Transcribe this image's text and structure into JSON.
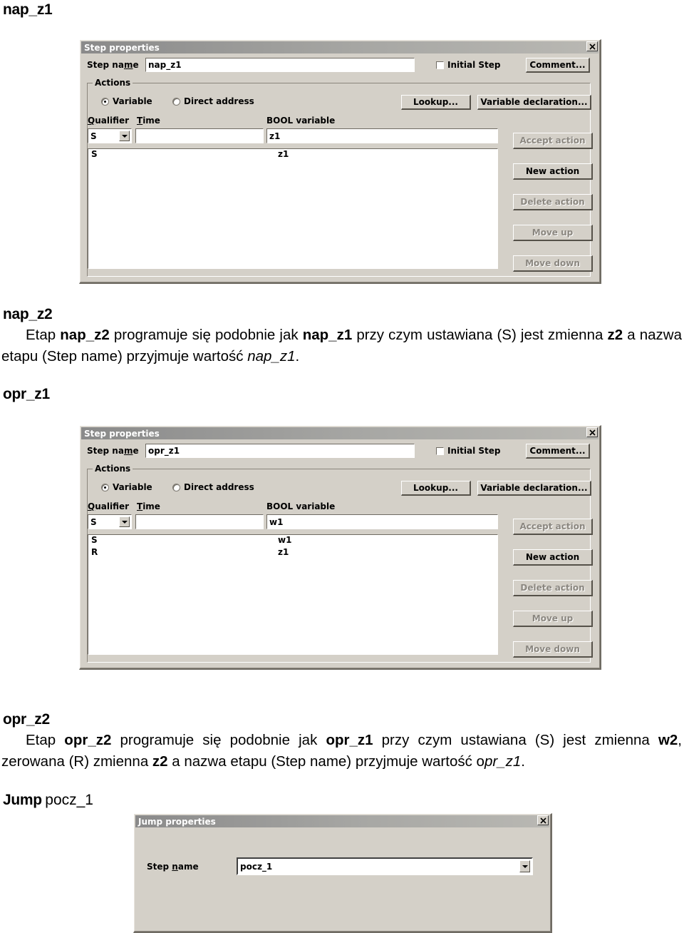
{
  "document": {
    "headings": {
      "nap_z1": "nap_z1",
      "nap_z2": "nap_z2",
      "opr_z1": "opr_z1",
      "opr_z2": "opr_z2",
      "jump": "Jump",
      "jump_target": "pocz_1"
    },
    "paragraphs": {
      "nap_z2": {
        "t1": "Etap ",
        "b1": "nap_z2",
        "t2": " programuje się podobnie jak ",
        "b2": "nap_z1",
        "t3": " przy czym ustawiana (S) jest zmienna ",
        "b3": "z2",
        "t4": " a nazwa etapu (Step name) przyjmuje wartość ",
        "i1": "nap_z1",
        "t5": "."
      },
      "opr_z2": {
        "t1": "Etap ",
        "b1": "opr_z2",
        "t2": " programuje się podobnie jak ",
        "b2": "opr_z1",
        "t3": " przy czym ustawiana (S) jest zmienna ",
        "b3": "w2",
        "t4": ", zerowana (R) zmienna ",
        "b4": "z2",
        "t5": " a nazwa etapu (Step name) przyjmuje wartość o",
        "i1": "pr_z1",
        "t6": "."
      }
    }
  },
  "dialog_step1": {
    "title": "Step properties",
    "close_icon": "close-icon",
    "step_name_label": "Step na",
    "step_name_label_underlined": "m",
    "step_name_label_tail": "e",
    "step_name_value": "nap_z1",
    "initial_step_label": "Initial Step",
    "initial_step_checked": false,
    "comment_button": "Comment...",
    "actions_group_label": "Actions",
    "radio_variable": "Variable",
    "radio_direct_address": "Direct address",
    "radio_selected": "Variable",
    "lookup_button": "Lookup...",
    "variable_declaration_button": "Variable declaration...",
    "qualifier_label_head": "Q",
    "qualifier_label_tail": "ualifier",
    "time_label_head": "T",
    "time_label_tail": "ime",
    "bool_variable_label": "BOOL variable",
    "qualifier_value": "S",
    "time_value": "",
    "bool_variable_value": "z1",
    "action_rows": [
      {
        "qualifier": "S",
        "variable": "z1"
      }
    ],
    "buttons": [
      {
        "label": "Accept action",
        "disabled": true
      },
      {
        "label": "New action",
        "disabled": false
      },
      {
        "label": "Delete action",
        "disabled": true
      },
      {
        "label": "Move up",
        "disabled": true
      },
      {
        "label": "Move down",
        "disabled": true
      }
    ]
  },
  "dialog_step2": {
    "title": "Step properties",
    "close_icon": "close-icon",
    "step_name_label": "Step na",
    "step_name_label_underlined": "m",
    "step_name_label_tail": "e",
    "step_name_value": "opr_z1",
    "initial_step_label": "Initial Step",
    "initial_step_checked": false,
    "comment_button": "Comment...",
    "actions_group_label": "Actions",
    "radio_variable": "Variable",
    "radio_direct_address": "Direct address",
    "radio_selected": "Variable",
    "lookup_button": "Lookup...",
    "variable_declaration_button": "Variable declaration...",
    "qualifier_label_head": "Q",
    "qualifier_label_tail": "ualifier",
    "time_label_head": "T",
    "time_label_tail": "ime",
    "bool_variable_label": "BOOL variable",
    "qualifier_value": "S",
    "time_value": "",
    "bool_variable_value": "w1",
    "action_rows": [
      {
        "qualifier": "S",
        "variable": "w1"
      },
      {
        "qualifier": "R",
        "variable": "z1"
      }
    ],
    "buttons": [
      {
        "label": "Accept action",
        "disabled": true
      },
      {
        "label": "New action",
        "disabled": false
      },
      {
        "label": "Delete action",
        "disabled": true
      },
      {
        "label": "Move up",
        "disabled": true
      },
      {
        "label": "Move down",
        "disabled": true
      }
    ]
  },
  "dialog_jump": {
    "title": "Jump properties",
    "close_icon": "close-icon",
    "step_name_label": "Step ",
    "step_name_label_underlined": "n",
    "step_name_label_tail": "ame",
    "step_name_value": "pocz_1",
    "dropdown_icon": "chevron-down-icon"
  },
  "colors": {
    "dialog_face": "#d4d0c8",
    "titlebar_left": "#8a8a8a",
    "titlebar_right": "#b9b8b3",
    "field_background": "#ffffff",
    "text": "#000000",
    "disabled_text": "#8b8780"
  }
}
